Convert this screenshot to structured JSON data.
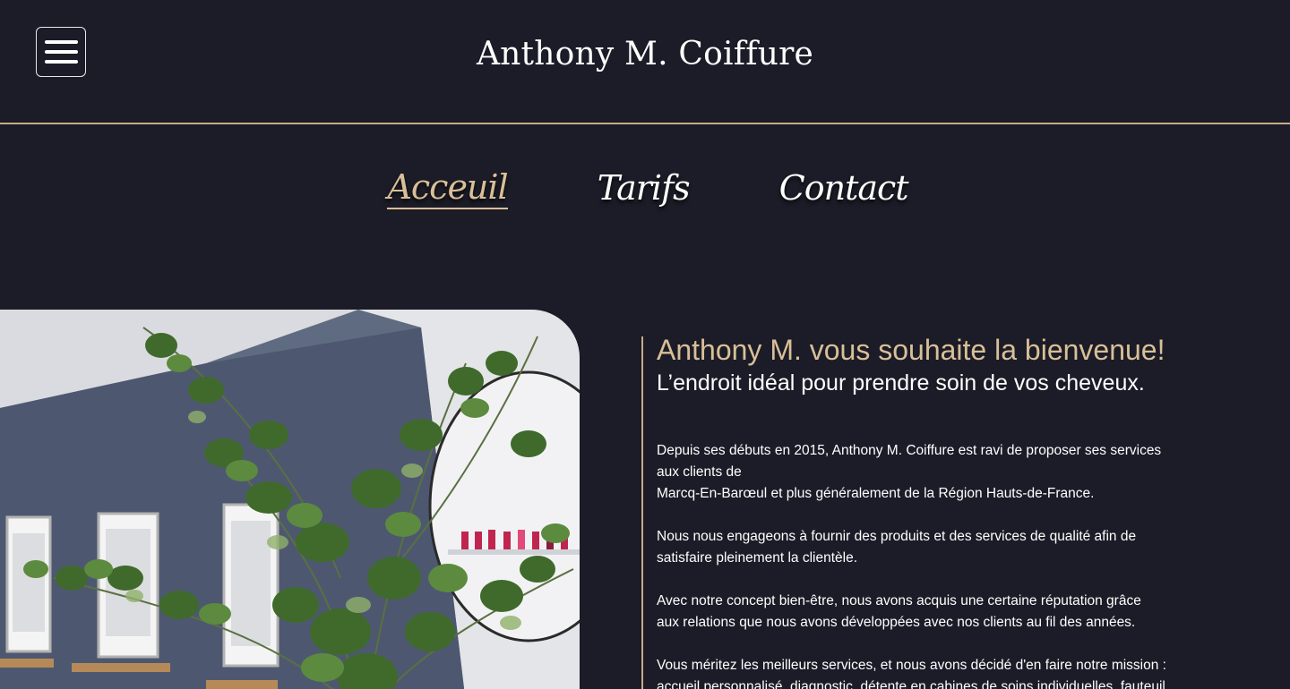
{
  "header": {
    "site_title": "Anthony M. Coiffure",
    "menu_icon": "hamburger-menu-icon"
  },
  "nav": {
    "items": [
      {
        "label": "Acceuil",
        "active": true
      },
      {
        "label": "Tarifs",
        "active": false
      },
      {
        "label": "Contact",
        "active": false
      }
    ]
  },
  "hero": {
    "image": "salon-interior-with-eucalyptus-plant"
  },
  "content": {
    "title": "Anthony M. vous souhaite la bienvenue!",
    "subtitle": "L’endroit idéal pour prendre soin de vos cheveux.",
    "paragraphs": {
      "p1": {
        "line1": "Depuis ses débuts en 2015, Anthony M. Coiffure est ravi de proposer ses services",
        "line2": "aux clients de",
        "line3": "Marcq-En-Barœul et plus généralement de la Région Hauts-de-France."
      },
      "p2": {
        "line1": "Nous nous engageons à fournir des produits et des services de qualité afin de",
        "line2": "satisfaire pleinement la clientèle."
      },
      "p3": {
        "line1": "Avec notre concept bien-être, nous avons acquis une certaine réputation grâce",
        "line2": "aux relations que nous avons développées avec nos clients au fil des années."
      },
      "p4": {
        "line1": "Vous méritez les meilleurs services, et nous avons décidé d'en faire notre mission :",
        "line2": "accueil personnalisé, diagnostic, détente en cabines de soins individuelles, fauteuil"
      }
    }
  },
  "colors": {
    "background": "#1b1c27",
    "accent": "#d9bf98",
    "divider": "#c9ab85",
    "text": "#ffffff"
  }
}
